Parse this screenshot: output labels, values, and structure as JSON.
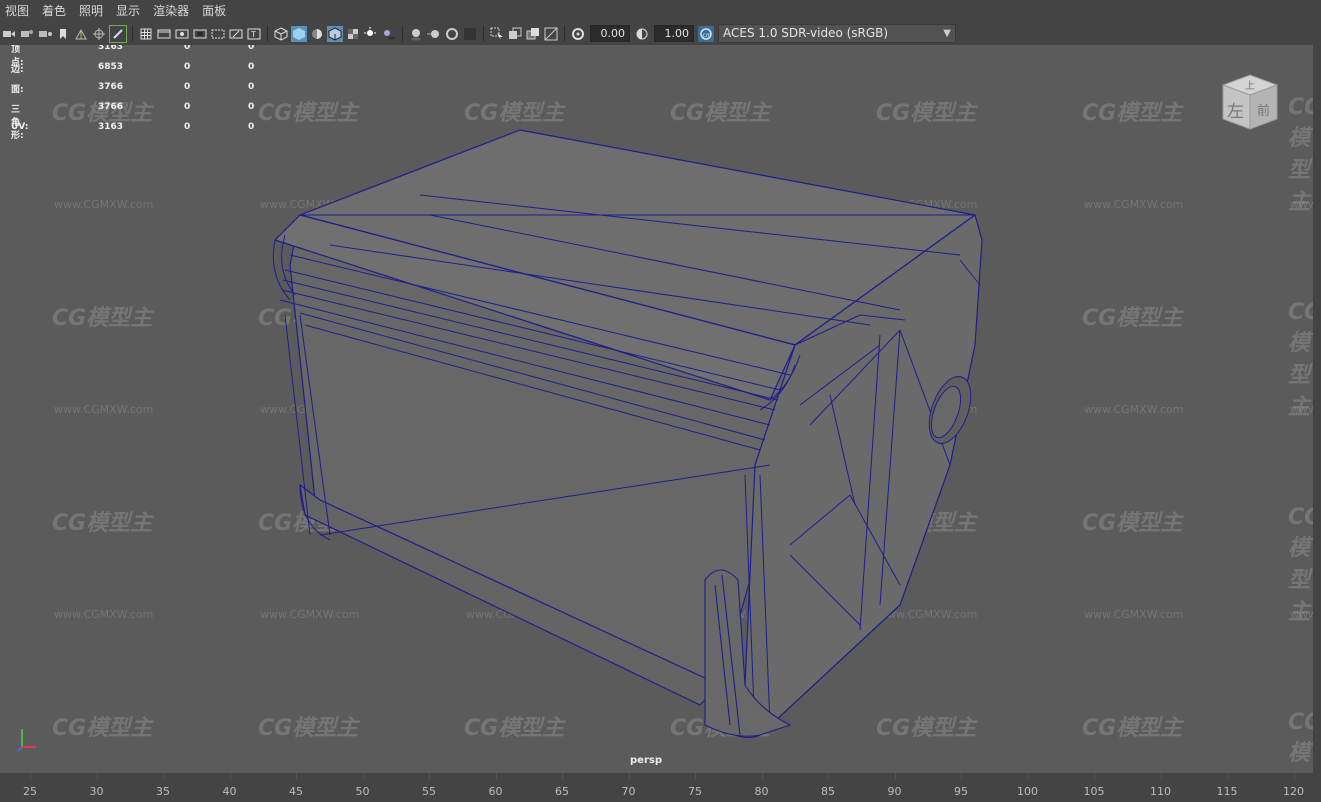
{
  "menubar": {
    "items": [
      "视图",
      "着色",
      "照明",
      "显示",
      "渲染器",
      "面板"
    ]
  },
  "toolbar": {
    "exposure_value": "0.00",
    "gamma_value": "1.00",
    "color_management": "ACES 1.0 SDR-video (sRGB)",
    "icons": [
      "camera-select-icon",
      "camera-attributes-icon",
      "bookmark-icon",
      "image-plane-icon",
      "2d-pan-zoom-icon",
      "grease-pencil-icon",
      "grid-icon",
      "film-gate-icon",
      "resolution-gate-icon",
      "gate-mask-icon",
      "field-chart-icon",
      "safe-action-icon",
      "safe-title-icon",
      "wireframe-icon",
      "smooth-shade-icon",
      "default-material-icon",
      "wireframe-on-shaded-icon",
      "textured-icon",
      "use-lights-icon",
      "shadows-icon",
      "screen-space-ao-icon",
      "motion-blur-icon",
      "anti-aliasing-icon",
      "depth-of-field-icon",
      "isolate-select-icon",
      "xray-icon",
      "xray-joints-icon",
      "xray-components-icon",
      "exposure-icon",
      "gamma-icon",
      "color-management-icon"
    ]
  },
  "hud": {
    "rows": [
      {
        "label": "顶点:",
        "v1": "3163",
        "v2": "0",
        "v3": "0"
      },
      {
        "label": "边:",
        "v1": "6853",
        "v2": "0",
        "v3": "0"
      },
      {
        "label": "面:",
        "v1": "3766",
        "v2": "0",
        "v3": "0"
      },
      {
        "label": "三角形:",
        "v1": "3766",
        "v2": "0",
        "v3": "0"
      },
      {
        "label": "UV:",
        "v1": "3163",
        "v2": "0",
        "v3": "0"
      }
    ]
  },
  "viewcube": {
    "top": "上",
    "left": "左",
    "front": "前"
  },
  "viewport": {
    "camera": "persp"
  },
  "watermark": {
    "logo": "CG模型主",
    "url": "www.CGMXW.com"
  },
  "timeline": {
    "ticks": [
      "25",
      "30",
      "35",
      "40",
      "45",
      "50",
      "55",
      "60",
      "65",
      "70",
      "75",
      "80",
      "85",
      "90",
      "95",
      "100",
      "105",
      "110",
      "115",
      "120"
    ]
  },
  "colors": {
    "viewport_bg": "#5b5b5b",
    "wireframe": "#1e1e8c",
    "mesh_fill": "#6c6c6c",
    "accent_selected": "#5aa3d6"
  }
}
